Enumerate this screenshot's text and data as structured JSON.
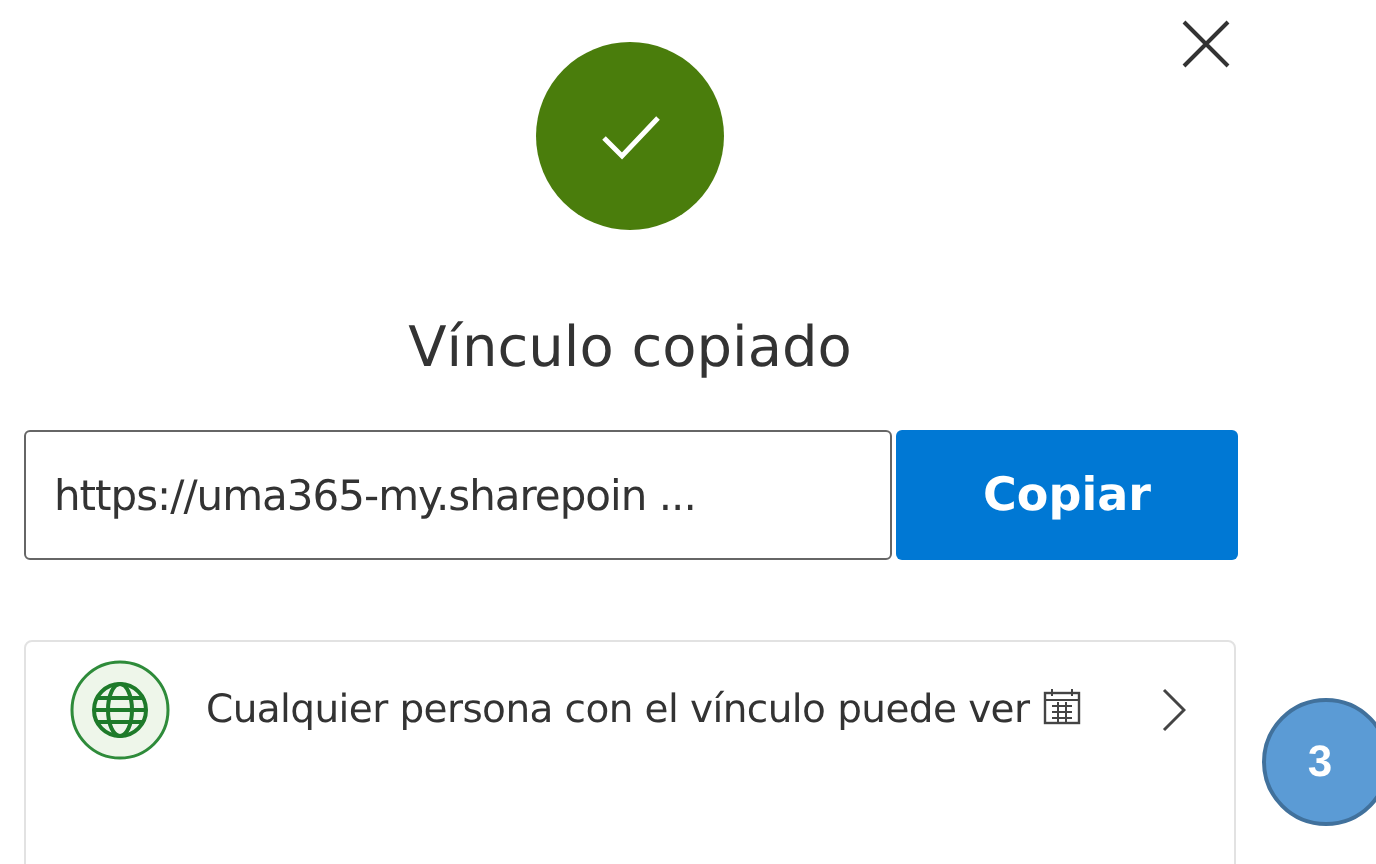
{
  "dialog": {
    "title": "Vínculo copiado",
    "link_field": {
      "value": "https://uma365-my.sharepoin ..."
    },
    "copy_button": "Copiar"
  },
  "permission": {
    "text": "Cualquier persona con el vínculo puede ver"
  },
  "callout_badge": "3"
}
